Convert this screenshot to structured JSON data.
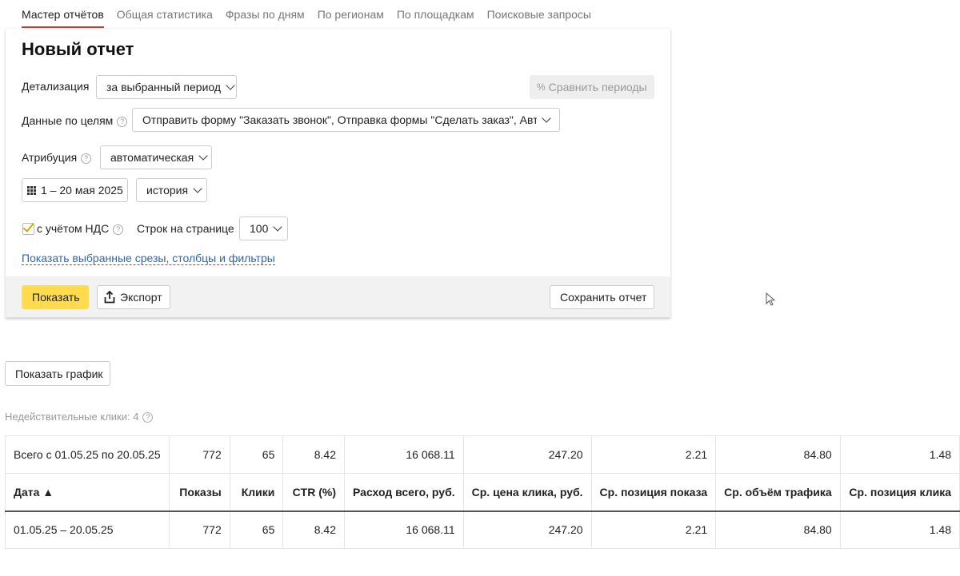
{
  "tabs": [
    "Мастер отчётов",
    "Общая статистика",
    "Фразы по дням",
    "По регионам",
    "По площадкам",
    "Поисковые запросы"
  ],
  "form": {
    "title": "Новый отчет",
    "detail_label": "Детализация",
    "detail_value": "за выбранный период",
    "compare_label": "Сравнить периоды",
    "goals_label": "Данные по целям",
    "goals_value": "Отправить форму \"Заказать звонок\", Отправка формы \"Сделать заказ\", Авто...",
    "attribution_label": "Атрибуция",
    "attribution_value": "автоматическая",
    "date_range": "1 – 20 мая 2025",
    "history_value": "история",
    "vat_label": "с учётом НДС",
    "vat_checked": true,
    "rows_label": "Строк на странице",
    "rows_value": "100",
    "show_link": "Показать выбранные срезы, столбцы и фильтры",
    "show_button": "Показать",
    "export_button": "Экспорт",
    "save_button": "Сохранить отчет"
  },
  "show_chart_button": "Показать график",
  "invalid_clicks": "Недействительные клики: 4",
  "table": {
    "total_row": [
      "Всего с 01.05.25 по 20.05.25",
      "772",
      "65",
      "8.42",
      "16 068.11",
      "247.20",
      "2.21",
      "84.80",
      "1.48"
    ],
    "headers": [
      "Дата ▲",
      "Показы",
      "Клики",
      "CTR (%)",
      "Расход всего, руб.",
      "Ср. цена клика, руб.",
      "Ср. позиция показа",
      "Ср. объём трафика",
      "Ср. позиция клика"
    ],
    "rows": [
      [
        "01.05.25 – 20.05.25",
        "772",
        "65",
        "8.42",
        "16 068.11",
        "247.20",
        "2.21",
        "84.80",
        "1.48"
      ]
    ]
  },
  "colors": {
    "accent": "#ffdb4d",
    "active_tab": "#d23a34",
    "link": "#2d67b5"
  }
}
